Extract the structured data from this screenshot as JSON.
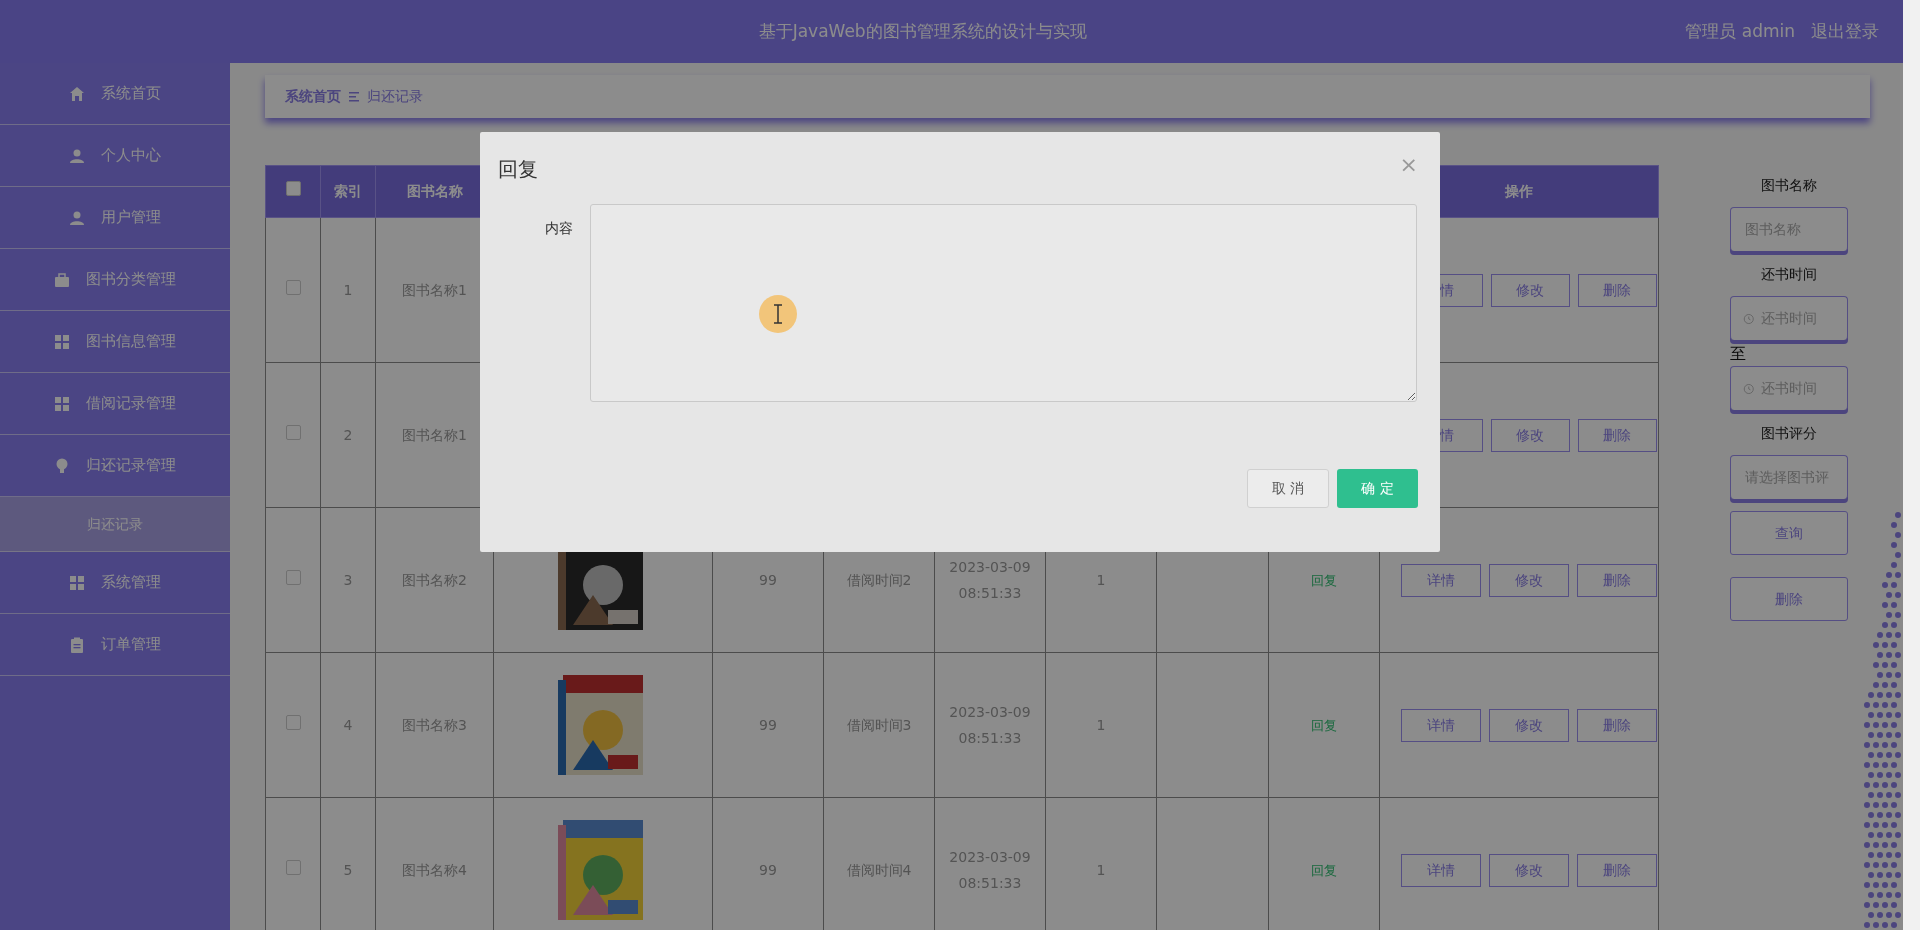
{
  "header": {
    "title": "基于JavaWeb的图书管理系统的设计与实现",
    "user": "管理员 admin",
    "logout": "退出登录"
  },
  "sidebar": {
    "items": [
      {
        "label": "系统首页",
        "selected": false
      },
      {
        "label": "个人中心",
        "selected": false
      },
      {
        "label": "用户管理",
        "selected": false
      },
      {
        "label": "图书分类管理",
        "selected": false
      },
      {
        "label": "图书信息管理",
        "selected": false
      },
      {
        "label": "借阅记录管理",
        "selected": false
      },
      {
        "label": "归还记录管理",
        "selected": false,
        "expanded": true,
        "children": [
          {
            "label": "归还记录",
            "selected": true
          }
        ]
      },
      {
        "label": "系统管理",
        "selected": false
      },
      {
        "label": "订单管理",
        "selected": false
      }
    ]
  },
  "breadcrumb": [
    "系统首页",
    "归还记录"
  ],
  "table": {
    "select_all": {
      "checked": false
    },
    "columns": [
      {
        "label": "索引"
      },
      {
        "label": "图书名称"
      },
      {
        "label": "操作"
      }
    ],
    "rows": [
      {
        "checked": false,
        "index": "1",
        "name": "图书名称1",
        "actions": [
          "情",
          "修改",
          "删除"
        ]
      },
      {
        "checked": false,
        "index": "2",
        "name": "图书名称1",
        "actions": [
          "情",
          "修改",
          "删除"
        ]
      },
      {
        "checked": false,
        "index": "3",
        "name": "图书名称2",
        "quantity": "99",
        "borrow_time": "借阅时间2",
        "return_time": "2023-03-09 08:51:33",
        "rating": "1",
        "reply": "回复",
        "actions": [
          "详情",
          "修改",
          "删除"
        ]
      },
      {
        "checked": false,
        "index": "4",
        "name": "图书名称3",
        "quantity": "99",
        "borrow_time": "借阅时间3",
        "return_time": "2023-03-09 08:51:33",
        "rating": "1",
        "reply": "回复",
        "actions": [
          "详情",
          "修改",
          "删除"
        ]
      },
      {
        "checked": false,
        "index": "5",
        "name": "图书名称4",
        "quantity": "99",
        "borrow_time": "借阅时间4",
        "return_time": "2023-03-09 08:51:33",
        "rating": "1",
        "reply": "回复",
        "actions": [
          "详情",
          "修改",
          "删除"
        ]
      }
    ]
  },
  "filters": {
    "fields": [
      {
        "kind": "text",
        "label": "图书名称",
        "placeholder": "图书名称"
      },
      {
        "kind": "date_range",
        "label": "还书时间",
        "from_placeholder": "还书时间",
        "separator": "至",
        "to_placeholder": "还书时间"
      },
      {
        "kind": "select",
        "label": "图书评分",
        "placeholder": "请选择图书评"
      }
    ],
    "buttons": [
      "查询",
      "删除"
    ]
  },
  "dialog": {
    "title": "回复",
    "close": "×",
    "field_label": "内容",
    "buttons": [
      "取 消",
      "确 定"
    ]
  }
}
